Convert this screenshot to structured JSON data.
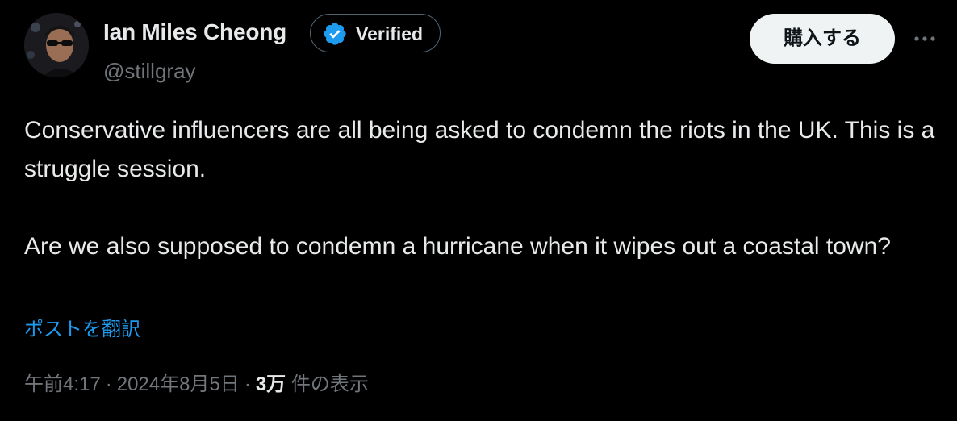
{
  "author": {
    "name": "Ian Miles Cheong",
    "handle": "@stillgray",
    "verified_label": "Verified"
  },
  "actions": {
    "subscribe_label": "購入する",
    "more_label": "···"
  },
  "tweet": {
    "paragraphs": [
      "Conservative influencers are all being asked to condemn the riots in the UK. This is a struggle session.",
      "Are we also supposed to condemn a hurricane when it wipes out a coastal town?"
    ],
    "translate_label": "ポストを翻訳"
  },
  "meta": {
    "time": "午前4:17",
    "separator": "·",
    "date": "2024年8月5日",
    "views_count": "3万",
    "views_label": "件の表示"
  },
  "colors": {
    "background": "#000000",
    "text_primary": "#e7e9ea",
    "text_secondary": "#71767b",
    "link": "#1d9bf0",
    "verified_badge": "#1d9bf0",
    "button_bg": "#eff3f4"
  },
  "icons": {
    "verified": "verified-badge-icon",
    "more": "more-dots-icon"
  }
}
